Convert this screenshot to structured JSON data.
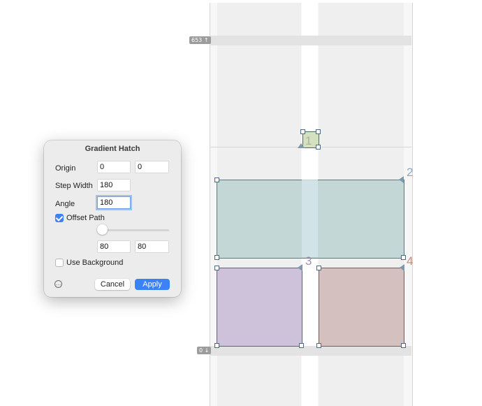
{
  "canvas": {
    "top_coordinate_badge": "653 ↑",
    "bottom_coordinate_badge": "0 ↓",
    "shape_labels": [
      "1",
      "2",
      "3",
      "4"
    ]
  },
  "dialog": {
    "title": "Gradient Hatch",
    "origin": {
      "label": "Origin",
      "x": "0",
      "y": "0"
    },
    "step_width": {
      "label": "Step Width",
      "value": "180"
    },
    "angle": {
      "label": "Angle",
      "value": "180"
    },
    "offset_path": {
      "label": "Offset Path",
      "checked": true,
      "slider_fraction": 0,
      "x": "80",
      "y": "80"
    },
    "use_background": {
      "label": "Use Background",
      "checked": false
    },
    "more_icon": "ellipsis-circle-icon",
    "cancel_label": "Cancel",
    "apply_label": "Apply"
  },
  "colors": {
    "accent": "#3b82f6",
    "shape_1_fill": "#d3e1c0",
    "shape_2_fill": "#c3d7d6",
    "shape_3_fill": "#cdc2d9",
    "shape_4_fill": "#d4c1bf"
  }
}
